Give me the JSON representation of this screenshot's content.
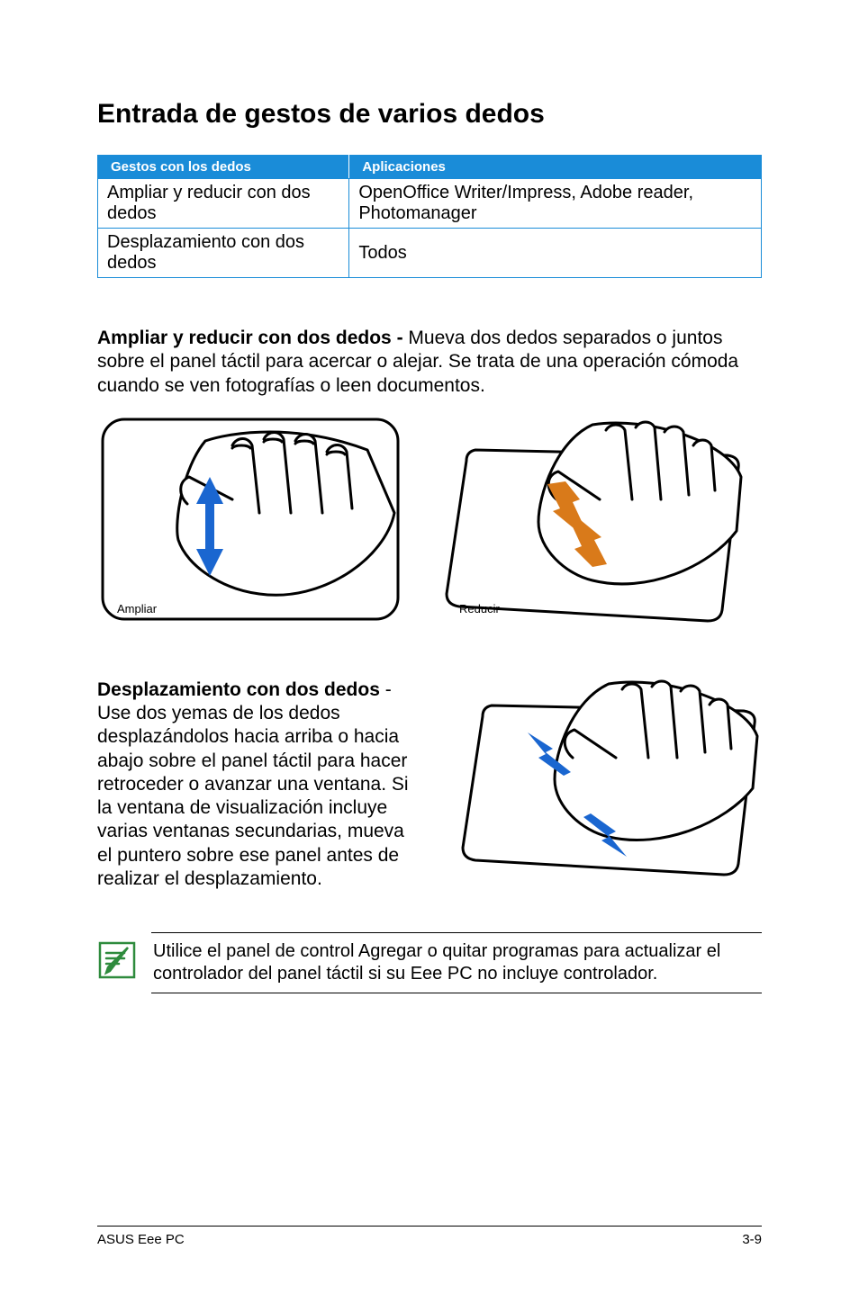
{
  "title": "Entrada de gestos de varios dedos",
  "table": {
    "headers": [
      "Gestos con los dedos",
      "Aplicaciones"
    ],
    "rows": [
      [
        "Ampliar y reducir con dos dedos",
        "OpenOffice Writer/Impress, Adobe reader, Photomanager"
      ],
      [
        "Desplazamiento con dos dedos",
        "Todos"
      ]
    ]
  },
  "section1": {
    "bold": "Ampliar y reducir con dos dedos - ",
    "text": "Mueva dos dedos separados o juntos sobre el panel táctil para acercar o alejar. Se trata de una operación cómoda cuando se ven fotografías o leen documentos."
  },
  "fig1_caption": "Ampliar",
  "fig2_caption": "Reducir",
  "section2": {
    "bold": "Desplazamiento con dos dedos",
    "text": " - Use dos yemas de los dedos desplazándolos hacia arriba o hacia abajo sobre el panel táctil para hacer retroceder o avanzar una ventana. Si la ventana de visualización incluye varias ventanas secundarias, mueva el puntero sobre ese panel antes de realizar el desplazamiento."
  },
  "note_text": "Utilice el panel de control Agregar o quitar programas para actualizar el controlador del panel táctil si su Eee PC no incluye controlador.",
  "footer_left": "ASUS Eee PC",
  "footer_right": "3-9"
}
